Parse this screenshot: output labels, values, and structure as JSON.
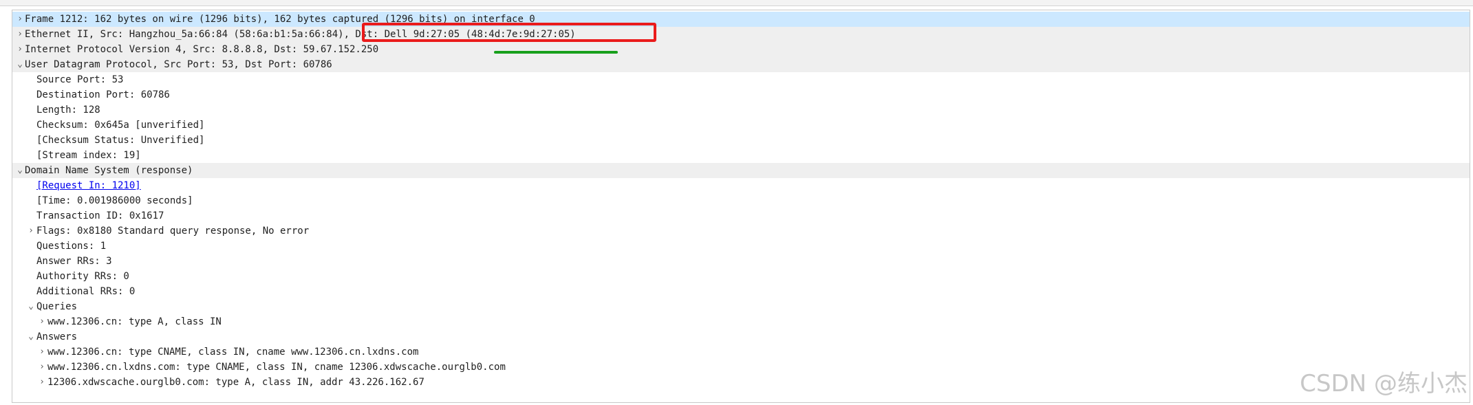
{
  "rows": [
    {
      "arrow": "›",
      "text": "Frame 1212: 162 bytes on wire (1296 bits), 162 bytes captured (1296 bits) on interface 0",
      "style": "sel",
      "level": 0
    },
    {
      "arrow": "›",
      "text": "Ethernet II, Src: Hangzhou_5a:66:84 (58:6a:b1:5a:66:84), Dst: Dell_9d:27:05 (48:4d:7e:9d:27:05)",
      "style": "hdr",
      "level": 0
    },
    {
      "arrow": "›",
      "text": "Internet Protocol Version 4, Src: 8.8.8.8, Dst: 59.67.152.250",
      "style": "hdr",
      "level": 0
    },
    {
      "arrow": "⌄",
      "text": "User Datagram Protocol, Src Port: 53, Dst Port: 60786",
      "style": "hdr",
      "level": 0
    },
    {
      "arrow": "",
      "text": "Source Port: 53",
      "style": "",
      "level": 1
    },
    {
      "arrow": "",
      "text": "Destination Port: 60786",
      "style": "",
      "level": 1
    },
    {
      "arrow": "",
      "text": "Length: 128",
      "style": "",
      "level": 1
    },
    {
      "arrow": "",
      "text": "Checksum: 0x645a [unverified]",
      "style": "",
      "level": 1
    },
    {
      "arrow": "",
      "text": "[Checksum Status: Unverified]",
      "style": "",
      "level": 1
    },
    {
      "arrow": "",
      "text": "[Stream index: 19]",
      "style": "",
      "level": 1
    },
    {
      "arrow": "⌄",
      "text": "Domain Name System (response)",
      "style": "hdr",
      "level": 0
    },
    {
      "arrow": "",
      "text": "[Request In: 1210]",
      "style": "link",
      "level": 1
    },
    {
      "arrow": "",
      "text": "[Time: 0.001986000 seconds]",
      "style": "",
      "level": 1
    },
    {
      "arrow": "",
      "text": "Transaction ID: 0x1617",
      "style": "",
      "level": 1
    },
    {
      "arrow": "›",
      "text": "Flags: 0x8180 Standard query response, No error",
      "style": "",
      "level": 1
    },
    {
      "arrow": "",
      "text": "Questions: 1",
      "style": "",
      "level": 1
    },
    {
      "arrow": "",
      "text": "Answer RRs: 3",
      "style": "",
      "level": 1
    },
    {
      "arrow": "",
      "text": "Authority RRs: 0",
      "style": "",
      "level": 1
    },
    {
      "arrow": "",
      "text": "Additional RRs: 0",
      "style": "",
      "level": 1
    },
    {
      "arrow": "⌄",
      "text": "Queries",
      "style": "",
      "level": 1
    },
    {
      "arrow": "›",
      "text": "www.12306.cn: type A, class IN",
      "style": "",
      "level": 2
    },
    {
      "arrow": "⌄",
      "text": "Answers",
      "style": "",
      "level": 1
    },
    {
      "arrow": "›",
      "text": "www.12306.cn: type CNAME, class IN, cname www.12306.cn.lxdns.com",
      "style": "",
      "level": 2
    },
    {
      "arrow": "›",
      "text": "www.12306.cn.lxdns.com: type CNAME, class IN, cname 12306.xdwscache.ourglb0.com",
      "style": "",
      "level": 2
    },
    {
      "arrow": "›",
      "text": "12306.xdwscache.ourglb0.com: type A, class IN, addr 43.226.162.67",
      "style": "",
      "level": 2
    }
  ],
  "watermark": "CSDN @练小杰",
  "annotations": {
    "highlight_color": "#ea1b1b",
    "underline_color": "#18a01c"
  },
  "colors": {
    "selected_row": "#cce8ff",
    "header_row": "#efefef",
    "link": "#0000ee"
  }
}
